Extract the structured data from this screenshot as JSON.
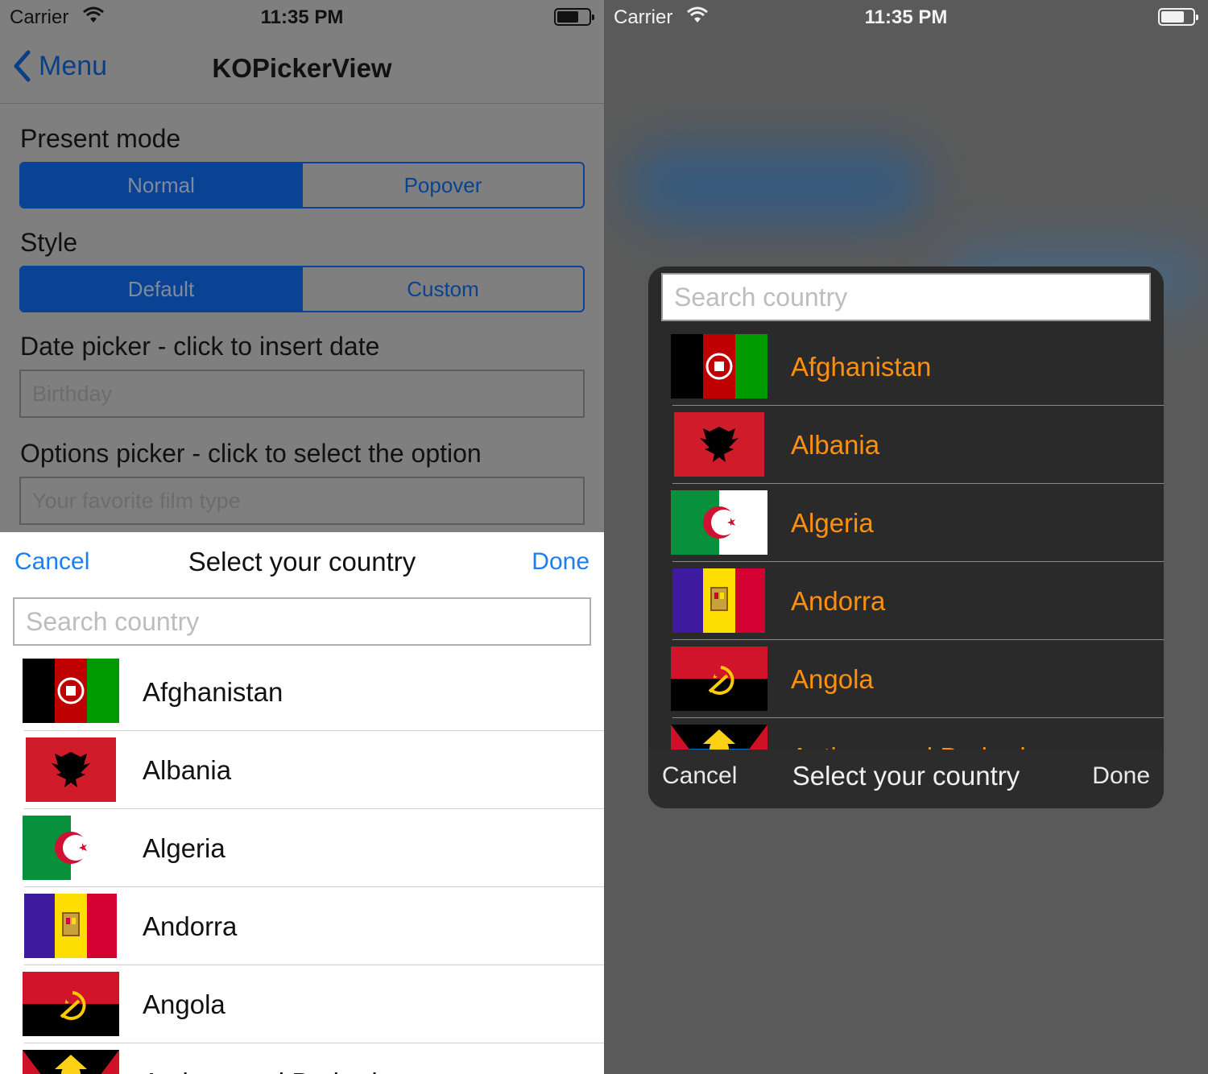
{
  "status_bar": {
    "carrier": "Carrier",
    "time": "11:35 PM"
  },
  "nav": {
    "back_label": "Menu",
    "title": "KOPickerView"
  },
  "form": {
    "present_mode": {
      "label": "Present mode",
      "options": [
        "Normal",
        "Popover"
      ],
      "selected": "Normal"
    },
    "style": {
      "label": "Style",
      "options": [
        "Default",
        "Custom"
      ],
      "selected": "Default"
    },
    "date_picker": {
      "label": "Date picker - click to insert date",
      "placeholder": "Birthday"
    },
    "options_picker": {
      "label": "Options picker - click to select the option",
      "placeholder": "Your favorite film type"
    }
  },
  "picker": {
    "cancel_label": "Cancel",
    "done_label": "Done",
    "title": "Select your country",
    "search_placeholder": "Search country",
    "countries": [
      "Afghanistan",
      "Albania",
      "Algeria",
      "Andorra",
      "Angola",
      "Antigua and Barbuda"
    ]
  },
  "colors": {
    "accent_blue": "#1a7ef8",
    "segment_blue": "#0a4294",
    "custom_country_text": "#ff8f0e",
    "popover_background": "#2a2a2a"
  }
}
